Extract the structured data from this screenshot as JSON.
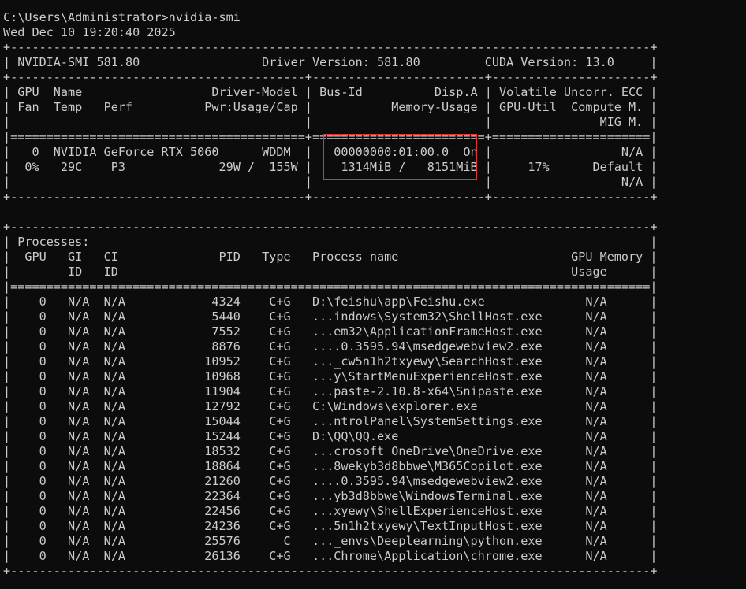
{
  "terminal": {
    "lines": [
      "C:\\Users\\Administrator>nvidia-smi",
      "Wed Dec 10 19:20:40 2025",
      "+-----------------------------------------------------------------------------------------+",
      "| NVIDIA-SMI 581.80                 Driver Version: 581.80         CUDA Version: 13.0     |",
      "+-----------------------------------------+------------------------+----------------------+",
      "| GPU  Name                  Driver-Model | Bus-Id          Disp.A | Volatile Uncorr. ECC |",
      "| Fan  Temp   Perf          Pwr:Usage/Cap |           Memory-Usage | GPU-Util  Compute M. |",
      "|                                         |                        |               MIG M. |",
      "|=========================================+========================+======================|",
      "|   0  NVIDIA GeForce RTX 5060      WDDM  |   00000000:01:00.0  On |                  N/A |",
      "|  0%   29C    P3             29W /  155W |    1314MiB /   8151MiB |     17%      Default |",
      "|                                         |                        |                  N/A |",
      "+-----------------------------------------+------------------------+----------------------+",
      "",
      "+-----------------------------------------------------------------------------------------+",
      "| Processes:                                                                              |",
      "|  GPU   GI   CI              PID   Type   Process name                        GPU Memory |",
      "|        ID   ID                                                               Usage      |",
      "|=========================================================================================|",
      "|    0   N/A  N/A            4324    C+G   D:\\feishu\\app\\Feishu.exe              N/A      |",
      "|    0   N/A  N/A            5440    C+G   ...indows\\System32\\ShellHost.exe      N/A      |",
      "|    0   N/A  N/A            7552    C+G   ...em32\\ApplicationFrameHost.exe      N/A      |",
      "|    0   N/A  N/A            8876    C+G   ....0.3595.94\\msedgewebview2.exe      N/A      |",
      "|    0   N/A  N/A           10952    C+G   ..._cw5n1h2txyewy\\SearchHost.exe      N/A      |",
      "|    0   N/A  N/A           10968    C+G   ...y\\StartMenuExperienceHost.exe      N/A      |",
      "|    0   N/A  N/A           11904    C+G   ...paste-2.10.8-x64\\Snipaste.exe      N/A      |",
      "|    0   N/A  N/A           12792    C+G   C:\\Windows\\explorer.exe               N/A      |",
      "|    0   N/A  N/A           15044    C+G   ...ntrolPanel\\SystemSettings.exe      N/A      |",
      "|    0   N/A  N/A           15244    C+G   D:\\QQ\\QQ.exe                          N/A      |",
      "|    0   N/A  N/A           18532    C+G   ...crosoft OneDrive\\OneDrive.exe      N/A      |",
      "|    0   N/A  N/A           18864    C+G   ...8wekyb3d8bbwe\\M365Copilot.exe      N/A      |",
      "|    0   N/A  N/A           21260    C+G   ....0.3595.94\\msedgewebview2.exe      N/A      |",
      "|    0   N/A  N/A           22364    C+G   ...yb3d8bbwe\\WindowsTerminal.exe      N/A      |",
      "|    0   N/A  N/A           22456    C+G   ...xyewy\\ShellExperienceHost.exe      N/A      |",
      "|    0   N/A  N/A           24236    C+G   ...5n1h2txyewy\\TextInputHost.exe      N/A      |",
      "|    0   N/A  N/A           25576      C   ..._envs\\Deeplearning\\python.exe      N/A      |",
      "|    0   N/A  N/A           26136    C+G   ...Chrome\\Application\\chrome.exe      N/A      |",
      "+-----------------------------------------------------------------------------------------+"
    ]
  }
}
